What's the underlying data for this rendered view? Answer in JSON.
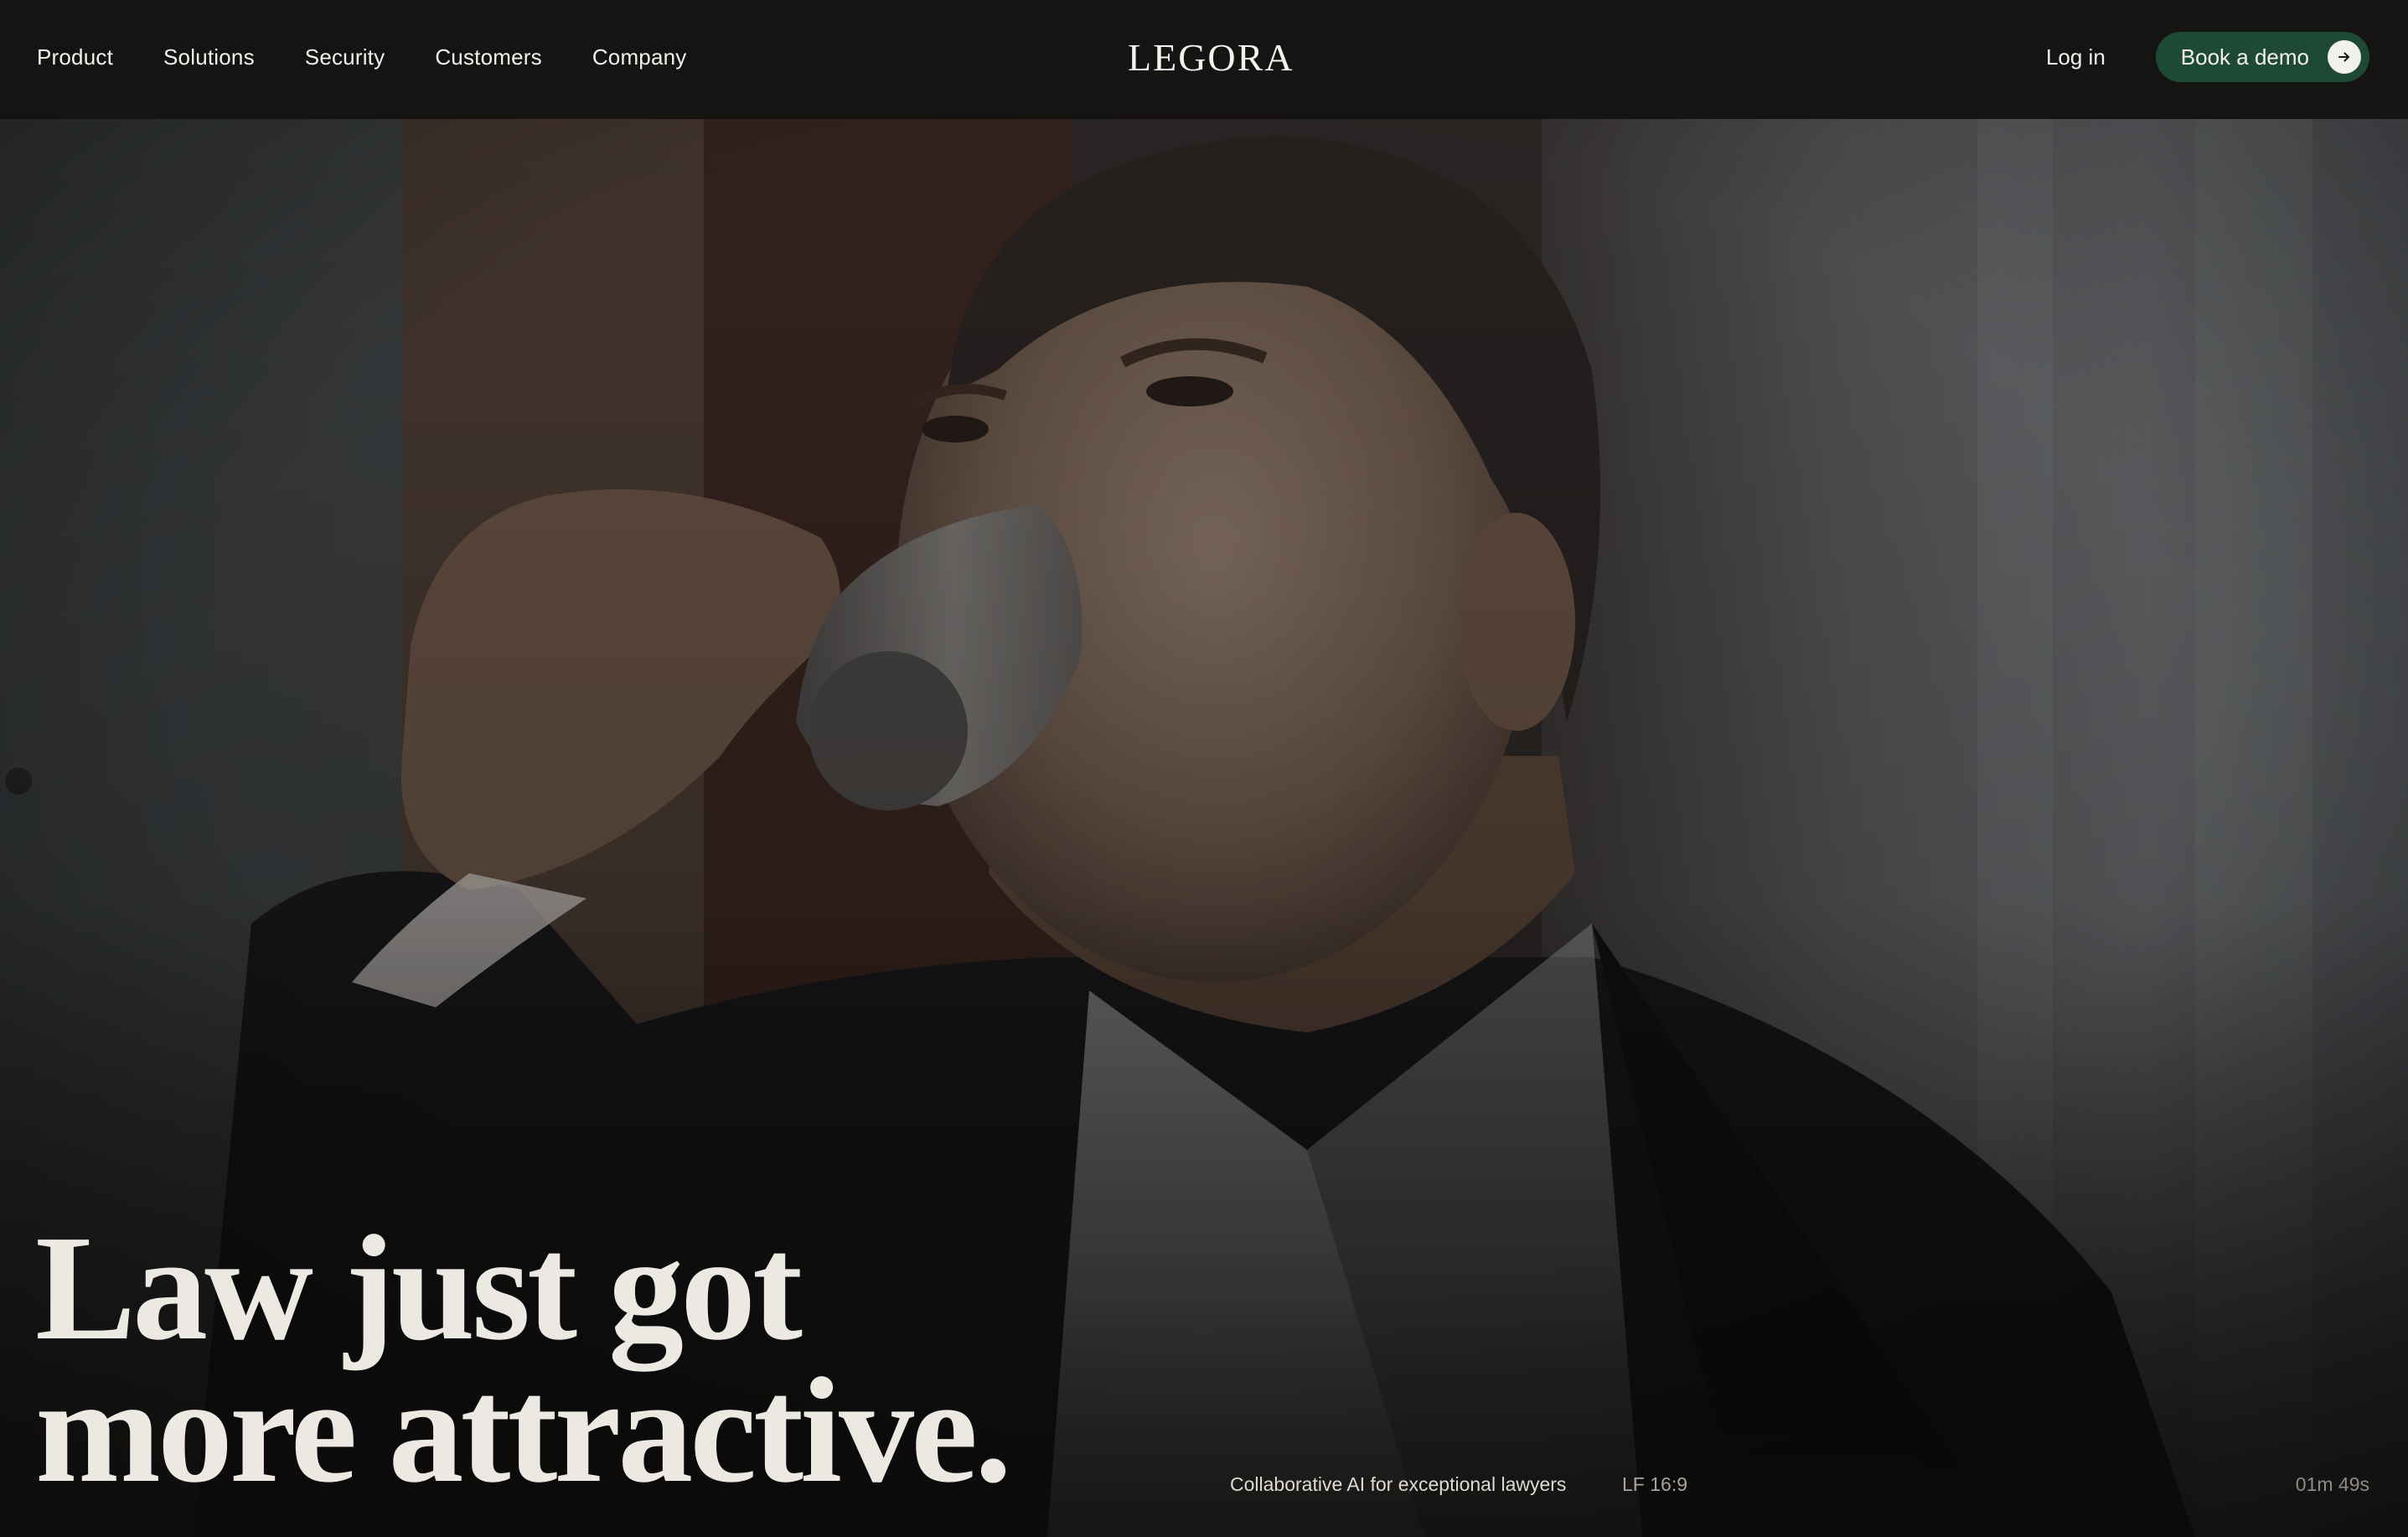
{
  "header": {
    "nav": [
      "Product",
      "Solutions",
      "Security",
      "Customers",
      "Company"
    ],
    "logo": "LEGORA",
    "login_label": "Log in",
    "demo_label": "Book a demo"
  },
  "hero": {
    "headline_line1": "Law just got",
    "headline_line2": "more attractive.",
    "caption": "Collaborative AI for exceptional lawyers",
    "format": "LF 16:9",
    "duration": "01m 49s"
  },
  "colors": {
    "header_bg": "#161412",
    "demo_button_bg": "#1e4a35",
    "text_light": "#ece9e3"
  },
  "icons": {
    "demo_arrow": "arrow-right-icon"
  }
}
